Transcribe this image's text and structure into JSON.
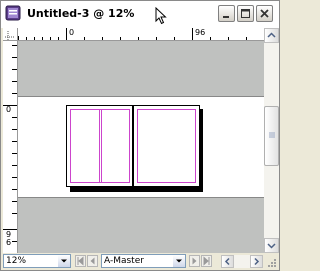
{
  "window": {
    "title": "Untitled-3 @ 12%",
    "app_icon": "indesign-document-icon",
    "controls": [
      "minimize-icon",
      "maximize-icon",
      "close-icon"
    ]
  },
  "rulers": {
    "top_labels": [
      "0",
      "96"
    ],
    "left_labels": [
      "0",
      "9\n6"
    ]
  },
  "statusbar": {
    "zoom_value": "12%",
    "page_value": "A-Master"
  },
  "colors": {
    "pasteboard": "#bfc1bf",
    "margin_guides": "#cc44cc",
    "page": "#ffffff"
  }
}
